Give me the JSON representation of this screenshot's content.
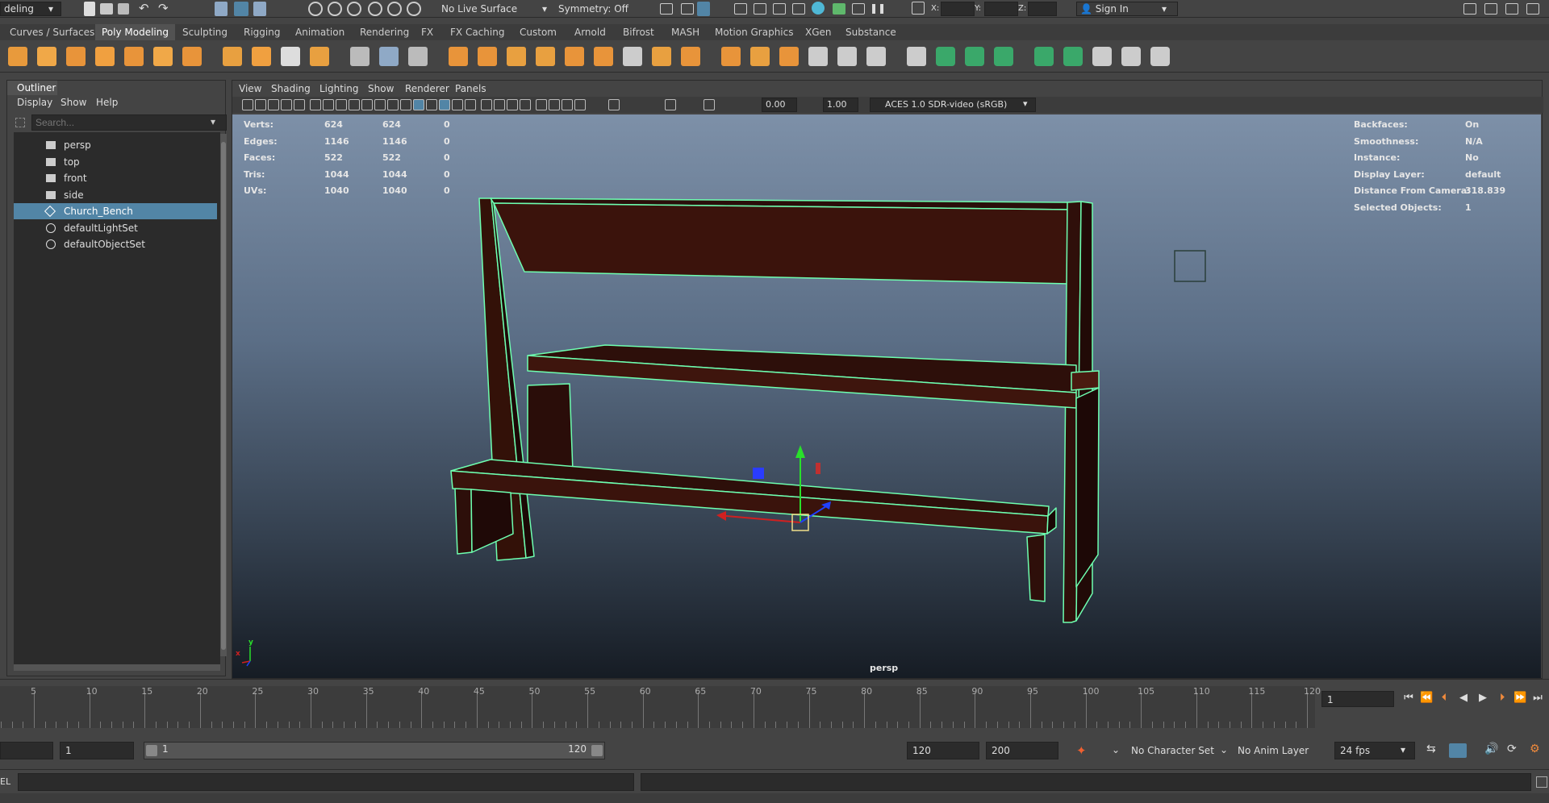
{
  "statusline": {
    "mode_menu": "deling",
    "live_surface": "No Live Surface",
    "symmetry": "Symmetry: Off",
    "x_label": "X:",
    "y_label": "Y:",
    "z_label": "Z:",
    "sign_in": "Sign In"
  },
  "shelf_tabs": [
    "Curves / Surfaces",
    "Poly Modeling",
    "Sculpting",
    "Rigging",
    "Animation",
    "Rendering",
    "FX",
    "FX Caching",
    "Custom",
    "Arnold",
    "Bifrost",
    "MASH",
    "Motion Graphics",
    "XGen",
    "Substance"
  ],
  "shelf_active_tab": "Poly Modeling",
  "shelf_icons": [
    "sphere-icon",
    "cube-icon",
    "cylinder-icon",
    "cone-icon",
    "torus-icon",
    "plane-icon",
    "disc-icon",
    "platonic-icon",
    "sparkle-icon",
    "text-icon",
    "svg-icon",
    "measure-icon",
    "snap-icon",
    "grid-icon",
    "combine-icon",
    "separate-icon",
    "extract-icon",
    "smooth-icon",
    "boolean-icon",
    "mirror-icon",
    "bevel-icon",
    "bridge-icon",
    "extrude-icon",
    "fill-icon",
    "poke-icon",
    "wedge-icon",
    "multi-cut-icon",
    "target-weld-icon",
    "edge-flow-icon",
    "slide-icon",
    "uv-icon",
    "planar-icon",
    "cylindrical-icon",
    "automatic-icon",
    "unfold-icon",
    "layout-icon",
    "sew-icon",
    "cut-uv-icon"
  ],
  "outliner": {
    "title": "Outliner",
    "menu": [
      "Display",
      "Show",
      "Help"
    ],
    "search_placeholder": "Search...",
    "items": [
      {
        "label": "persp",
        "type": "camera"
      },
      {
        "label": "top",
        "type": "camera"
      },
      {
        "label": "front",
        "type": "camera"
      },
      {
        "label": "side",
        "type": "camera"
      },
      {
        "label": "Church_Bench",
        "type": "mesh",
        "selected": true
      },
      {
        "label": "defaultLightSet",
        "type": "set"
      },
      {
        "label": "defaultObjectSet",
        "type": "set"
      }
    ]
  },
  "viewport": {
    "menu": [
      "View",
      "Shading",
      "Lighting",
      "Show",
      "Renderer",
      "Panels"
    ],
    "field1": "0.00",
    "field2": "1.00",
    "colorspace": "ACES 1.0 SDR-video (sRGB)",
    "camera_label": "persp",
    "hud_left": [
      {
        "label": "Verts:",
        "v1": "624",
        "v2": "624",
        "v3": "0"
      },
      {
        "label": "Edges:",
        "v1": "1146",
        "v2": "1146",
        "v3": "0"
      },
      {
        "label": "Faces:",
        "v1": "522",
        "v2": "522",
        "v3": "0"
      },
      {
        "label": "Tris:",
        "v1": "1044",
        "v2": "1044",
        "v3": "0"
      },
      {
        "label": "UVs:",
        "v1": "1040",
        "v2": "1040",
        "v3": "0"
      }
    ],
    "hud_right": [
      {
        "label": "Backfaces:",
        "value": "On"
      },
      {
        "label": "Smoothness:",
        "value": "N/A"
      },
      {
        "label": "Instance:",
        "value": "No"
      },
      {
        "label": "Display Layer:",
        "value": "default"
      },
      {
        "label": "Distance From Camera:",
        "value": "318.839"
      },
      {
        "label": "Selected Objects:",
        "value": "1"
      }
    ],
    "axis_y": "y",
    "axis_x": "x"
  },
  "timeline": {
    "ticks": [
      "5",
      "10",
      "15",
      "20",
      "25",
      "30",
      "35",
      "40",
      "45",
      "50",
      "55",
      "60",
      "65",
      "70",
      "75",
      "80",
      "85",
      "90",
      "95",
      "100",
      "105",
      "110",
      "115",
      "120"
    ],
    "current_frame": "1"
  },
  "range": {
    "start": "1",
    "slider_start": "1",
    "slider_end": "120",
    "end": "120",
    "anim_end": "200",
    "character_set": "No Character Set",
    "anim_layer": "No Anim Layer",
    "fps": "24 fps"
  },
  "cmdline": {
    "label": "EL"
  },
  "colors": {
    "selection": "#5285a6",
    "wireframe": "#6effb0",
    "wood": "#3a1410"
  }
}
